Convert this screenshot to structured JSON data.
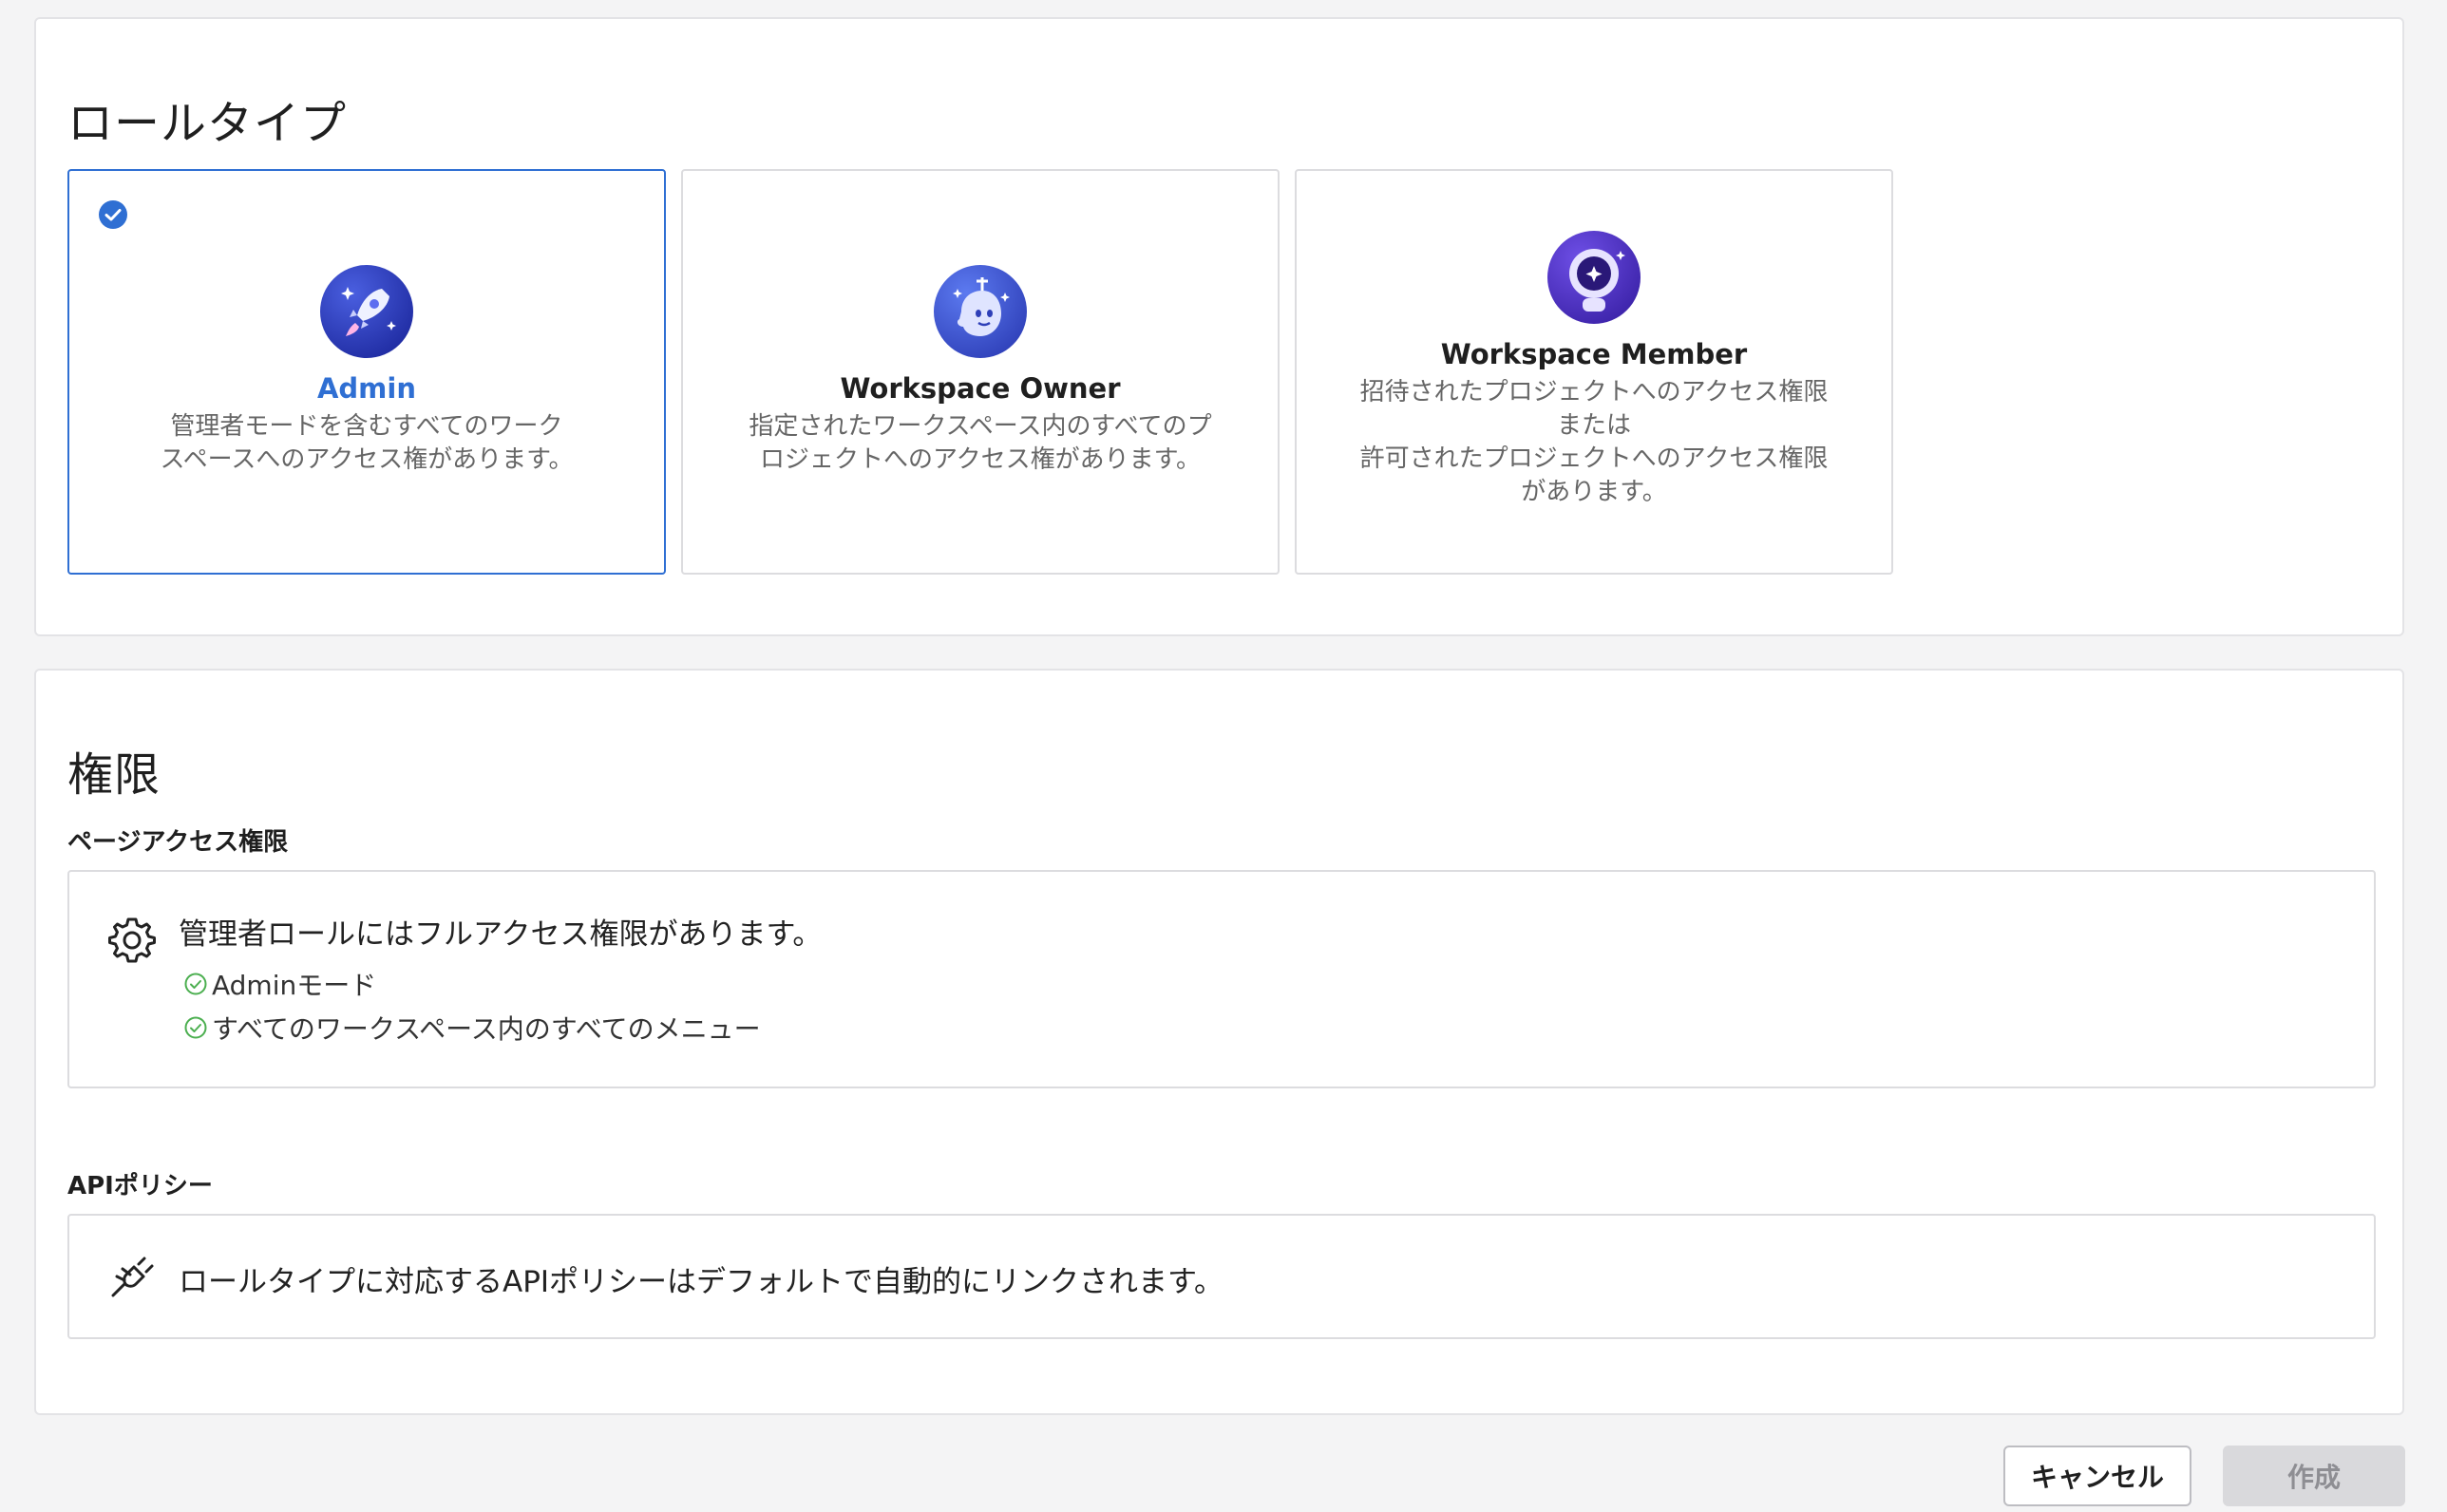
{
  "role_section": {
    "title": "ロールタイプ",
    "cards": [
      {
        "name": "Admin",
        "description": "管理者モードを含むすべてのワーク\nスペースへのアクセス権があります。",
        "selected": true,
        "icon": "rocket-icon"
      },
      {
        "name": "Workspace Owner",
        "description": "指定されたワークスペース内のすべてのプ\nロジェクトへのアクセス権があります。",
        "selected": false,
        "icon": "ghost-icon"
      },
      {
        "name": "Workspace Member",
        "description": "招待されたプロジェクトへのアクセス権限\nまたは\n許可されたプロジェクトへのアクセス権限\nがあります。",
        "selected": false,
        "icon": "astronaut-icon"
      }
    ]
  },
  "permission_section": {
    "title": "権限",
    "page_access": {
      "label": "ページアクセス権限",
      "message": "管理者ロールにはフルアクセス権限があります。",
      "items": [
        "Adminモード",
        "すべてのワークスペース内のすべてのメニュー"
      ],
      "icon": "gear-icon"
    },
    "api_policy": {
      "label": "APIポリシー",
      "message": "ロールタイプに対応するAPIポリシーはデフォルトで自動的にリンクされます。",
      "icon": "plug-icon"
    }
  },
  "footer": {
    "cancel_label": "キャンセル",
    "create_label": "作成"
  },
  "colors": {
    "accent": "#2f6fd3",
    "success": "#4caf50",
    "disabled": "#d9d9dc"
  }
}
